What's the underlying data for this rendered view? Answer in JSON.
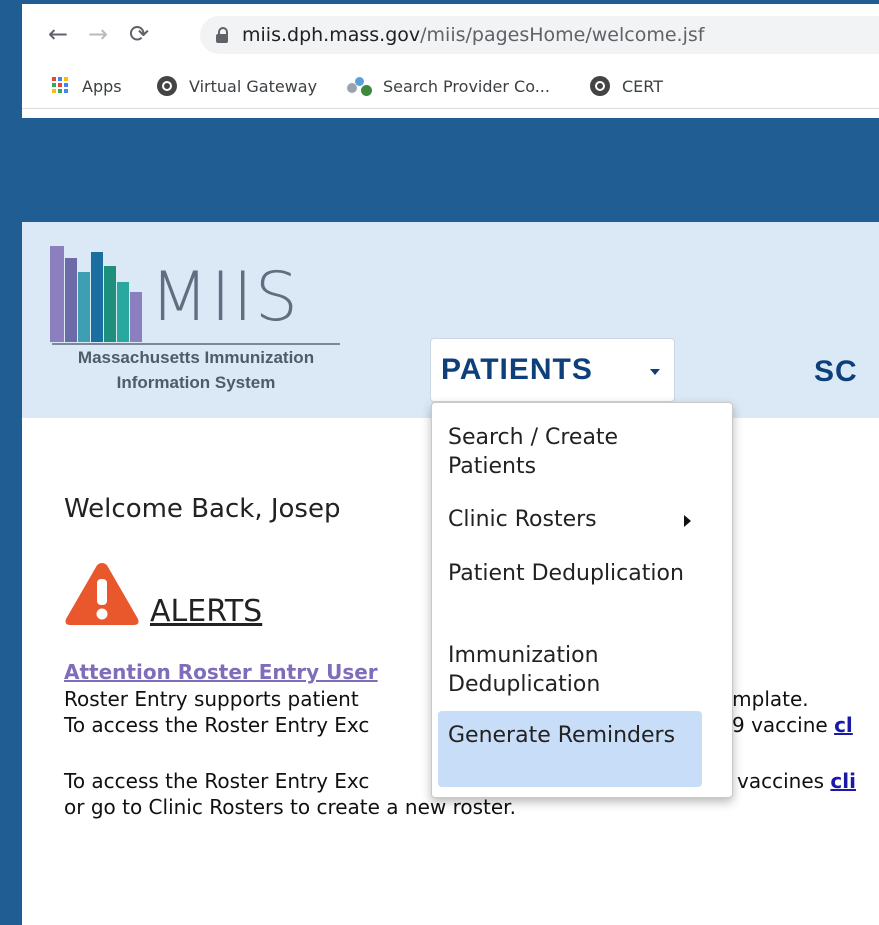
{
  "browser": {
    "url_domain": "miis.dph.mass.gov",
    "url_path": "/miis/pagesHome/welcome.jsf",
    "nav": {
      "back_icon": "←",
      "forward_icon": "→",
      "reload_icon": "⟳"
    },
    "bookmarks": [
      {
        "label": "Apps",
        "icon": "apps-grid-icon"
      },
      {
        "label": "Virtual Gateway",
        "icon": "globe-icon"
      },
      {
        "label": "Search Provider Co...",
        "icon": "people-icon"
      },
      {
        "label": "CERT",
        "icon": "globe-icon"
      }
    ]
  },
  "logo": {
    "title": "MIIS",
    "subtitle_line1": "Massachusetts Immunization",
    "subtitle_line2": "Information System",
    "bar_colors": [
      "#8b7fbf",
      "#6d6aa8",
      "#3f9fb2",
      "#1a6fa0",
      "#1f8f7d",
      "#2aa8a0",
      "#8b7fbf"
    ]
  },
  "nav": {
    "patients_label": "PATIENTS",
    "next_menu_label": "SC"
  },
  "dropdown": {
    "items": [
      {
        "label": "Search / Create Patients"
      },
      {
        "label": "Clinic Rosters"
      },
      {
        "label": "Patient Deduplication"
      },
      {
        "label": "Immunization Deduplication"
      },
      {
        "label": "Generate Reminders"
      }
    ],
    "highlighted": "Generate Reminders"
  },
  "main": {
    "welcome": "Welcome Back, Josep",
    "alerts_title": "ALERTS",
    "attention_link": "Attention Roster Entry User",
    "line1_visible": "Roster Entry supports patient",
    "line1_tail": "template.",
    "line2_visible": "To access the Roster Entry Exc",
    "line2_tail": "9 vaccine ",
    "line2_link": "cl",
    "line3_visible": "To access the Roster Entry Exc",
    "line3_tail": "vaccines ",
    "line3_link": "cli",
    "line4": "or go to Clinic Rosters to create a new roster."
  },
  "colors": {
    "banner": "#1f5d93",
    "header_bg": "#dbe9f7",
    "nav_text": "#0d3f7a",
    "highlight": "#c8ddf7",
    "attention_link": "#7f6dba",
    "alert_icon": "#e8582c"
  }
}
